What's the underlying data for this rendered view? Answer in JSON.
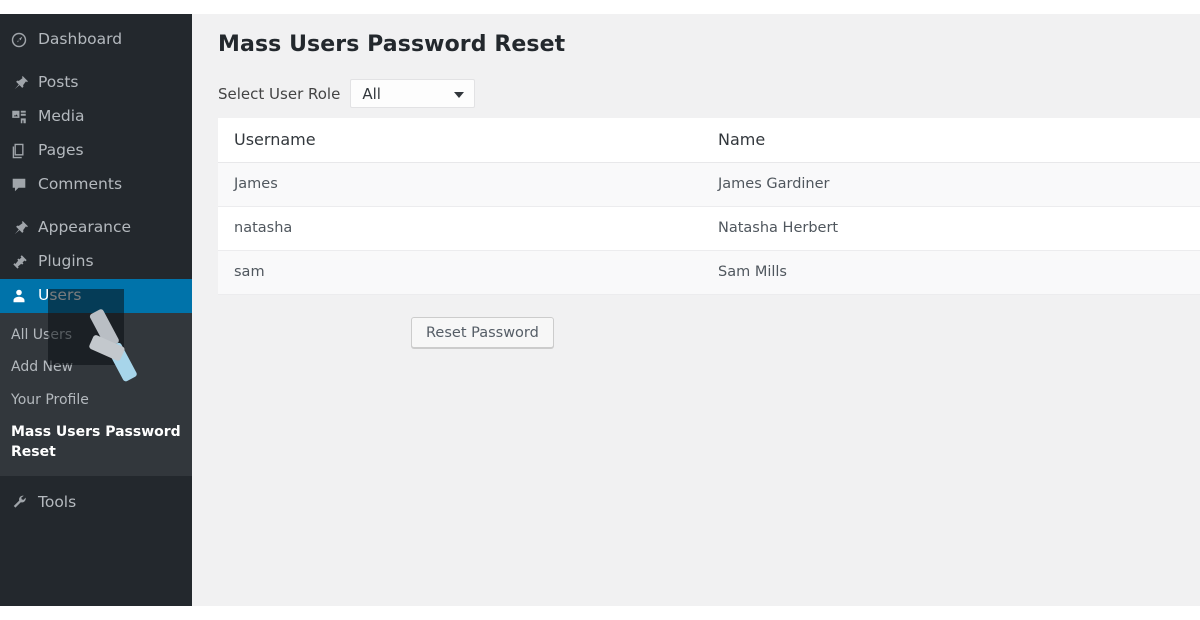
{
  "window": {
    "background_color": "#f1f1f2",
    "sidebar_color": "#23282d",
    "submenu_color": "#32373c",
    "accent_color": "#0073aa"
  },
  "sidebar": {
    "items": [
      {
        "label": "Dashboard",
        "icon": "dashboard-icon",
        "current": false
      },
      {
        "label": "Posts",
        "icon": "pin-icon",
        "current": false
      },
      {
        "label": "Media",
        "icon": "media-icon",
        "current": false
      },
      {
        "label": "Pages",
        "icon": "pages-icon",
        "current": false
      },
      {
        "label": "Comments",
        "icon": "comments-icon",
        "current": false
      },
      {
        "label": "Appearance",
        "icon": "appearance-icon",
        "current": false
      },
      {
        "label": "Plugins",
        "icon": "plugins-icon",
        "current": false
      },
      {
        "label": "Users",
        "icon": "users-icon",
        "current": true
      },
      {
        "label": "Tools",
        "icon": "tools-icon",
        "current": false
      }
    ],
    "submenu": {
      "parent": "Users",
      "items": [
        {
          "label": "All Users",
          "current": false
        },
        {
          "label": "Add New",
          "current": false
        },
        {
          "label": "Your Profile",
          "current": false
        },
        {
          "label": "Mass Users Password Reset",
          "current": true
        }
      ]
    }
  },
  "main": {
    "title": "Mass Users Password Reset",
    "role_filter": {
      "label": "Select User Role",
      "value": "All",
      "caret_icon": "chevron-down-icon"
    },
    "table": {
      "columns": [
        "Username",
        "Name"
      ],
      "rows": [
        {
          "username": "James",
          "name": "James Gardiner"
        },
        {
          "username": "natasha",
          "name": "Natasha Herbert"
        },
        {
          "username": "sam",
          "name": "Sam Mills"
        }
      ]
    },
    "submit_label": "Reset Password"
  }
}
